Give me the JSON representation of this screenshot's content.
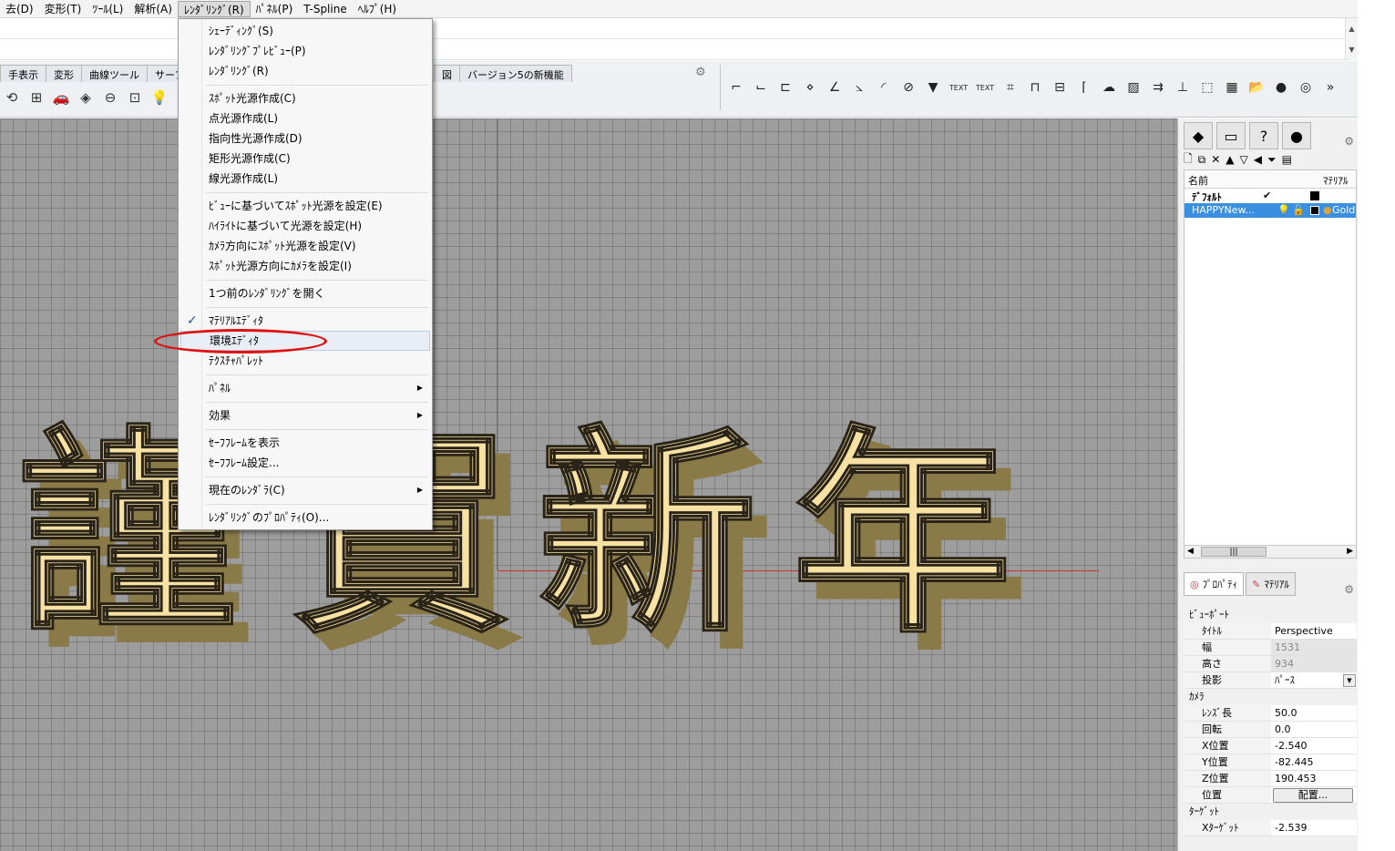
{
  "menubar": [
    "去(D)",
    "変形(T)",
    "ﾂｰﾙ(L)",
    "解析(A)",
    "ﾚﾝﾀﾞﾘﾝｸﾞ(R)",
    "ﾊﾟﾈﾙ(P)",
    "T-Spline",
    "ﾍﾙﾌﾟ(H)"
  ],
  "toolbar_tabs": [
    "手表示",
    "変形",
    "曲線ツール",
    "サーフェス"
  ],
  "toolbar_tabs_right": [
    "図",
    "バージョン5の新機能"
  ],
  "right_toolbar_texts": [
    "TEXT",
    "TEXT"
  ],
  "dropdown": {
    "items": [
      {
        "label": "ｼｪｰﾃﾞｨﾝｸﾞ(S)"
      },
      {
        "label": "ﾚﾝﾀﾞﾘﾝｸﾞﾌﾟﾚﾋﾞｭｰ(P)"
      },
      {
        "label": "ﾚﾝﾀﾞﾘﾝｸﾞ(R)"
      },
      {
        "label": "ｽﾎﾟｯﾄ光源作成(C)"
      },
      {
        "label": "点光源作成(L)"
      },
      {
        "label": "指向性光源作成(D)"
      },
      {
        "label": "矩形光源作成(C)"
      },
      {
        "label": "線光源作成(L)"
      },
      {
        "label": "ﾋﾞｭｰに基づいてｽﾎﾟｯﾄ光源を設定(E)"
      },
      {
        "label": "ﾊｲﾗｲﾄに基づいて光源を設定(H)"
      },
      {
        "label": "ｶﾒﾗ方向にｽﾎﾟｯﾄ光源を設定(V)"
      },
      {
        "label": "ｽﾎﾟｯﾄ光源方向にｶﾒﾗを設定(I)"
      },
      {
        "label": "1つ前のﾚﾝﾀﾞﾘﾝｸﾞを開く"
      },
      {
        "label": "ﾏﾃﾘｱﾙｴﾃﾞｨﾀ",
        "checked": true
      },
      {
        "label": "環境ｴﾃﾞｨﾀ",
        "highlighted": true
      },
      {
        "label": "ﾃｸｽﾁｬﾊﾟﾚｯﾄ"
      },
      {
        "label": "ﾊﾟﾈﾙ",
        "submenu": true
      },
      {
        "label": "効果",
        "submenu": true
      },
      {
        "label": "ｾｰﾌﾌﾚｰﾑを表示"
      },
      {
        "label": "ｾｰﾌﾌﾚｰﾑ設定..."
      },
      {
        "label": "現在のﾚﾝﾀﾞﾗ(C)",
        "submenu": true
      },
      {
        "label": "ﾚﾝﾀﾞﾘﾝｸﾞのﾌﾟﾛﾊﾟﾃｨ(O)..."
      }
    ]
  },
  "viewport": {
    "scene_text": [
      "謹",
      "賀",
      "新",
      "年"
    ],
    "text_color": "#f7e2a3"
  },
  "layers": {
    "header_name": "名前",
    "header_material": "ﾏﾃﾘｱﾙ",
    "rows": [
      {
        "name": "ﾃﾞﾌｫﾙﾄ",
        "check": "✔"
      },
      {
        "name": "HAPPYNew...",
        "material": "Gold",
        "selected": true
      }
    ]
  },
  "prop_tabs": [
    "ﾌﾟﾛﾊﾟﾃｨ",
    "ﾏﾃﾘｱﾙ"
  ],
  "properties": {
    "sec_viewport": "ﾋﾞｭｰﾎﾟｰﾄ",
    "title_k": "ﾀｲﾄﾙ",
    "title_v": "Perspective",
    "width_k": "幅",
    "width_v": "1531",
    "height_k": "高さ",
    "height_v": "934",
    "proj_k": "投影",
    "proj_v": "ﾊﾟｰｽ",
    "sec_camera": "ｶﾒﾗ",
    "lens_k": "ﾚﾝｽﾞ長",
    "lens_v": "50.0",
    "rot_k": "回転",
    "rot_v": "0.0",
    "x_k": "X位置",
    "x_v": "-2.540",
    "y_k": "Y位置",
    "y_v": "-82.445",
    "z_k": "Z位置",
    "z_v": "190.453",
    "pos_k": "位置",
    "pos_btn": "配置...",
    "sec_target": "ﾀｰｹﾞｯﾄ",
    "xt_k": "Xﾀｰｹﾞｯﾄ",
    "xt_v": "-2.539"
  }
}
